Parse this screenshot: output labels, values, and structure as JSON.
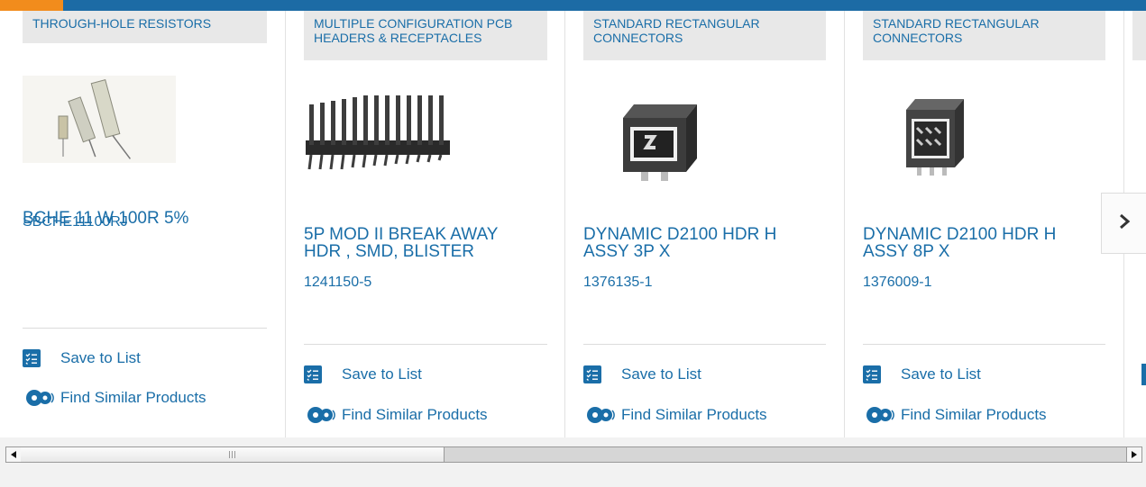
{
  "products": [
    {
      "category": "THROUGH-HOLE RESISTORS",
      "title": "BCHE 11 W 100R 5%",
      "part_number": "SBCHE11100RJ",
      "save_label": "Save to List",
      "similar_label": "Find Similar Products",
      "image_icon": "resistor-image"
    },
    {
      "category": "MULTIPLE CONFIGURATION PCB HEADERS & RECEPTACLES",
      "title": "5P MOD II BREAK AWAY HDR , SMD, BLISTER",
      "part_number": "1241150-5",
      "save_label": "Save to List",
      "similar_label": "Find Similar Products",
      "image_icon": "pin-header-image"
    },
    {
      "category": "STANDARD RECTANGULAR CONNECTORS",
      "title": "DYNAMIC D2100 HDR H ASSY 3P X",
      "part_number": "1376135-1",
      "save_label": "Save to List",
      "similar_label": "Find Similar Products",
      "image_icon": "connector-3p-image"
    },
    {
      "category": "STANDARD RECTANGULAR CONNECTORS",
      "title": "DYNAMIC D2100 HDR H ASSY 8P X",
      "part_number": "1376009-1",
      "save_label": "Save to List",
      "similar_label": "Find Similar Products",
      "image_icon": "connector-8p-image"
    }
  ],
  "next_icon": "chevron-right-icon",
  "colors": {
    "link": "#1a6ea8",
    "accent_bar": "#1c6ba5",
    "accent_orange": "#f28c1c",
    "category_bg": "#e8e8e8"
  },
  "scrollbar": {
    "left_icon": "scroll-left-arrow-icon",
    "right_icon": "scroll-right-arrow-icon"
  }
}
